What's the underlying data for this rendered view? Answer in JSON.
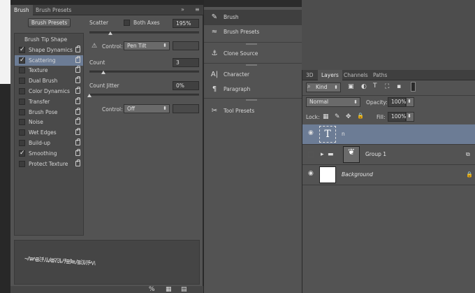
{
  "brush_panel": {
    "tabs": [
      "Brush",
      "Brush Presets"
    ],
    "menu_icons": [
      "»",
      "≡"
    ],
    "presets_button": "Brush Presets",
    "tip_items": [
      {
        "label": "Brush Tip Shape",
        "checked": null,
        "selected": false,
        "locked": false
      },
      {
        "label": "Shape Dynamics",
        "checked": true,
        "selected": false,
        "locked": true
      },
      {
        "label": "Scattering",
        "checked": true,
        "selected": true,
        "locked": true
      },
      {
        "label": "Texture",
        "checked": false,
        "selected": false,
        "locked": true
      },
      {
        "label": "Dual Brush",
        "checked": false,
        "selected": false,
        "locked": true
      },
      {
        "label": "Color Dynamics",
        "checked": false,
        "selected": false,
        "locked": true
      },
      {
        "label": "Transfer",
        "checked": false,
        "selected": false,
        "locked": true
      },
      {
        "label": "Brush Pose",
        "checked": false,
        "selected": false,
        "locked": true
      },
      {
        "label": "Noise",
        "checked": false,
        "selected": false,
        "locked": true
      },
      {
        "label": "Wet Edges",
        "checked": false,
        "selected": false,
        "locked": true
      },
      {
        "label": "Build-up",
        "checked": false,
        "selected": false,
        "locked": true
      },
      {
        "label": "Smoothing",
        "checked": true,
        "selected": false,
        "locked": true
      },
      {
        "label": "Protect Texture",
        "checked": false,
        "selected": false,
        "locked": true
      }
    ],
    "scatter_label": "Scatter",
    "both_axes_label": "Both Axes",
    "scatter_value": "195%",
    "control1_label": "Control:",
    "control1_value": "Pen Tilt",
    "count_label": "Count",
    "count_value": "3",
    "count_jitter_label": "Count Jitter",
    "count_jitter_value": "0%",
    "control2_label": "Control:",
    "control2_value": "Off",
    "warning_icon": "⚠",
    "preview_text": "~ﾊ≡ﾍ≣ﾐﾁﾉﾑﾒ≣ﾏﾐﾙﾉﾁ≣ﾀ≡ﾉ≣ﾐﾙﾘﾁﾍﾊ",
    "bottom_icons": [
      "%",
      "▦",
      "▤"
    ]
  },
  "dock": {
    "items": [
      {
        "label": "Brush",
        "icon": "brush-icon",
        "glyph": "✎",
        "active": true
      },
      {
        "label": "Brush Presets",
        "icon": "brush-presets-icon",
        "glyph": "≈",
        "active": false
      },
      {
        "label": "Clone Source",
        "icon": "clone-source-icon",
        "glyph": "⚓",
        "active": false
      },
      {
        "label": "Character",
        "icon": "character-icon",
        "glyph": "A|",
        "active": false
      },
      {
        "label": "Paragraph",
        "icon": "paragraph-icon",
        "glyph": "¶",
        "active": false
      },
      {
        "label": "Tool Presets",
        "icon": "tool-presets-icon",
        "glyph": "✂",
        "active": false
      }
    ]
  },
  "layers_panel": {
    "tabs": [
      "3D",
      "Layers",
      "Channels",
      "Paths"
    ],
    "filter_label": "Kind",
    "filter_icons": [
      "▣",
      "◐",
      "T",
      "⛶",
      "▪"
    ],
    "blend_mode": "Normal",
    "opacity_label": "Opacity:",
    "opacity_value": "100%",
    "lock_label": "Lock:",
    "lock_icons": [
      "▦",
      "✎",
      "✥",
      "🔒"
    ],
    "fill_label": "Fill:",
    "fill_value": "100%",
    "layers": [
      {
        "name": "n",
        "type": "text",
        "visible": true,
        "selected": true
      },
      {
        "name": "Group 1",
        "type": "group",
        "visible": false,
        "selected": false
      },
      {
        "name": "Background",
        "type": "background",
        "visible": true,
        "selected": false
      }
    ]
  }
}
